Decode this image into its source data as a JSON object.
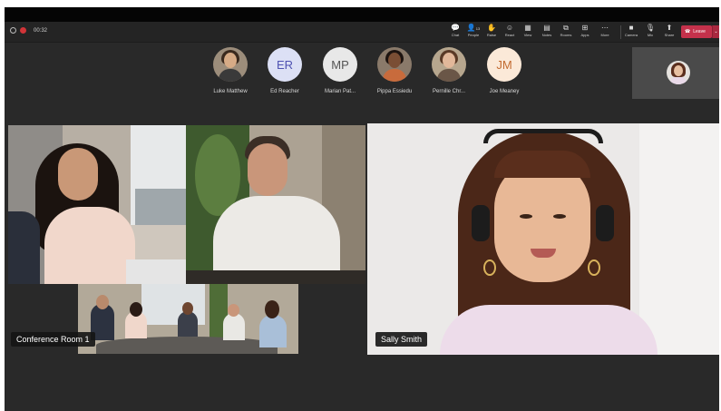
{
  "meeting": {
    "timer": "00:32"
  },
  "toolbar": {
    "buttons": [
      {
        "label": "Chat",
        "icon": "chat-icon",
        "glyph": "💬"
      },
      {
        "label": "People",
        "icon": "people-icon",
        "glyph": "👤",
        "count": "13"
      },
      {
        "label": "Raise",
        "icon": "hand-icon",
        "glyph": "✋"
      },
      {
        "label": "React",
        "icon": "smiley-icon",
        "glyph": "☺"
      },
      {
        "label": "View",
        "icon": "grid-icon",
        "glyph": "▦"
      },
      {
        "label": "Notes",
        "icon": "notes-icon",
        "glyph": "▤"
      },
      {
        "label": "Rooms",
        "icon": "rooms-icon",
        "glyph": "⧉"
      },
      {
        "label": "Apps",
        "icon": "apps-icon",
        "glyph": "⊞"
      },
      {
        "label": "More",
        "icon": "more-icon",
        "glyph": "⋯"
      },
      {
        "label": "Camera",
        "icon": "camera-icon",
        "glyph": "■"
      },
      {
        "label": "Mic",
        "icon": "mic-icon",
        "glyph": "🎙"
      },
      {
        "label": "Share",
        "icon": "share-icon",
        "glyph": "⬆"
      }
    ],
    "leave_label": "Leave",
    "leave_color": "#c4314b"
  },
  "participants": [
    {
      "name": "Luke Matthew",
      "type": "photo"
    },
    {
      "name": "Ed Reacher",
      "type": "initials",
      "initials": "ER",
      "bg": "#dce0f5",
      "fg": "#4f52b2"
    },
    {
      "name": "Marian Pat...",
      "type": "initials",
      "initials": "MP",
      "bg": "#e8e8e8",
      "fg": "#555555"
    },
    {
      "name": "Pippa Essiedu",
      "type": "photo"
    },
    {
      "name": "Pernille Chr...",
      "type": "photo"
    },
    {
      "name": "Joe Meaney",
      "type": "initials",
      "initials": "JM",
      "bg": "#fbe9d8",
      "fg": "#c26a30"
    }
  ],
  "stage": {
    "conference_label": "Conference Room 1",
    "speaker_label": "Sally Smith"
  }
}
